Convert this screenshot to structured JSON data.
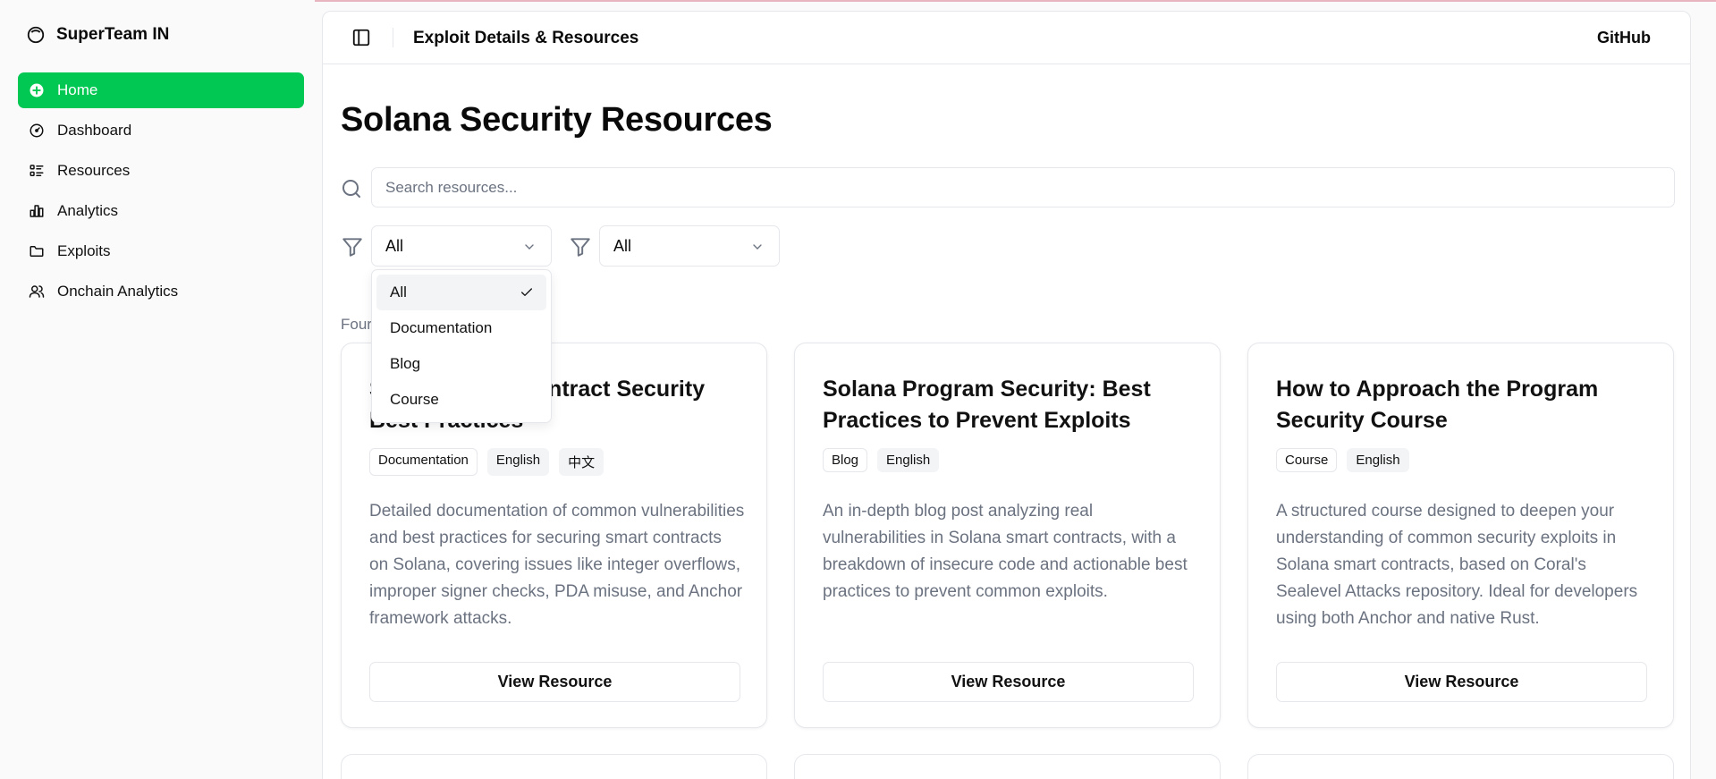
{
  "brand": {
    "name": "SuperTeam IN"
  },
  "sidebar": {
    "items": [
      {
        "label": "Home",
        "icon": "plus-circle-icon",
        "active": true
      },
      {
        "label": "Dashboard",
        "icon": "gauge-icon"
      },
      {
        "label": "Resources",
        "icon": "list-icon"
      },
      {
        "label": "Analytics",
        "icon": "bar-chart-icon"
      },
      {
        "label": "Exploits",
        "icon": "folder-icon"
      },
      {
        "label": "Onchain Analytics",
        "icon": "users-icon"
      }
    ]
  },
  "header": {
    "title": "Exploit Details & Resources",
    "github": "GitHub"
  },
  "page": {
    "title": "Solana Security Resources"
  },
  "search": {
    "placeholder": "Search resources..."
  },
  "filters": {
    "type_value": "All",
    "language_value": "All"
  },
  "found_text": "Four",
  "dropdown": {
    "options": [
      {
        "label": "All",
        "selected": true
      },
      {
        "label": "Documentation"
      },
      {
        "label": "Blog"
      },
      {
        "label": "Course"
      }
    ]
  },
  "cards": [
    {
      "title": "Solana Smart Contract Security Best Practices",
      "tags": [
        "Documentation",
        "English",
        "中文"
      ],
      "description": "Detailed documentation of common vulnerabilities and best practices for securing smart contracts on Solana, covering issues like integer overflows, improper signer checks, PDA misuse, and Anchor framework attacks.",
      "button": "View Resource"
    },
    {
      "title": "Solana Program Security: Best Practices to Prevent Exploits",
      "tags": [
        "Blog",
        "English"
      ],
      "description": "An in-depth blog post analyzing real vulnerabilities in Solana smart contracts, with a breakdown of insecure code and actionable best practices to prevent common exploits.",
      "button": "View Resource"
    },
    {
      "title": "How to Approach the Program Security Course",
      "tags": [
        "Course",
        "English"
      ],
      "description": "A structured course designed to deepen your understanding of common security exploits in Solana smart contracts, based on Coral's Sealevel Attacks repository. Ideal for developers using both Anchor and native Rust.",
      "button": "View Resource"
    }
  ],
  "colors": {
    "accent": "#00c853",
    "border": "#e5e7eb",
    "muted_text": "#6b7280"
  }
}
